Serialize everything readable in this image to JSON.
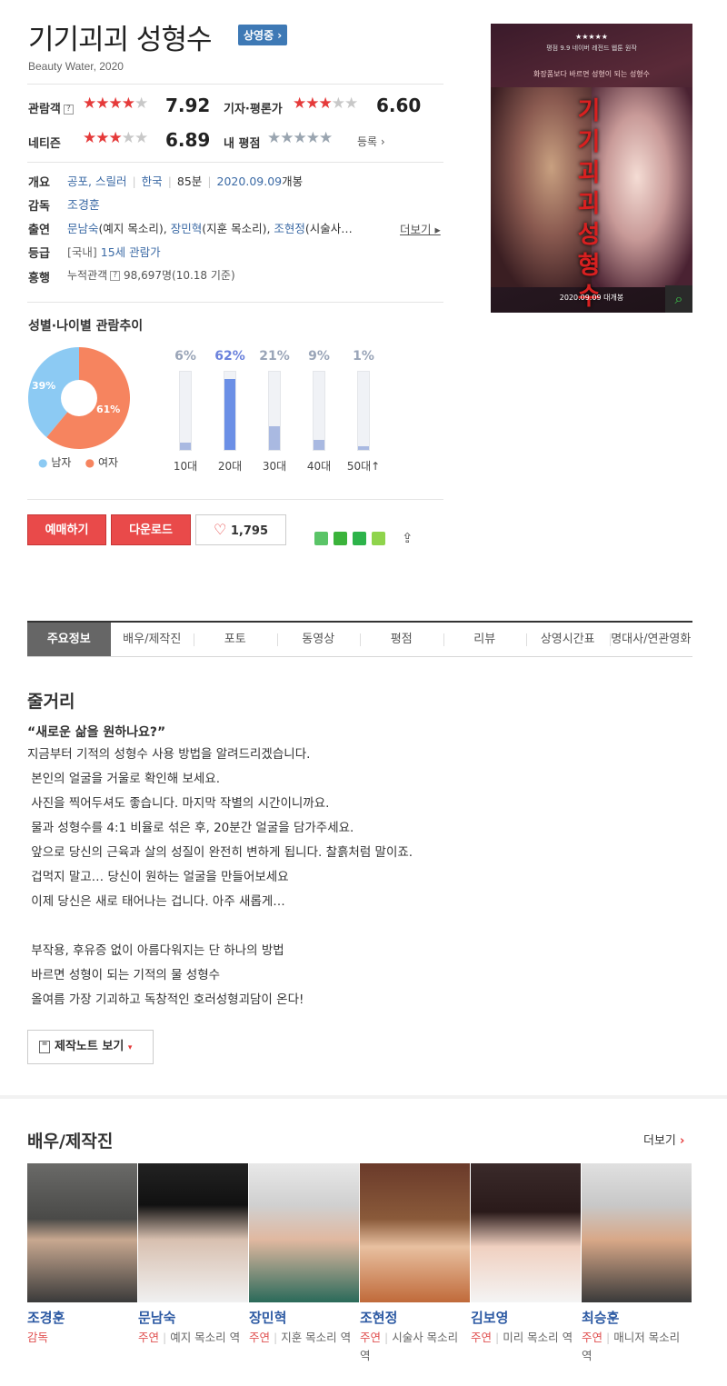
{
  "movie": {
    "title": "기기괴괴 성형수",
    "status_badge": "상영중",
    "subtitle": "Beauty Water, 2020"
  },
  "ratings": {
    "audience": {
      "label": "관람객",
      "score": "7.92",
      "stars": 4
    },
    "critics": {
      "label": "기자·평론가",
      "score": "6.60",
      "stars": 3.5
    },
    "netizen": {
      "label": "네티즌",
      "score": "6.89",
      "stars": 3.5
    },
    "my": {
      "label": "내 평점",
      "action": "등록"
    }
  },
  "info": {
    "overview_label": "개요",
    "genres": "공포, 스릴러",
    "country": "한국",
    "runtime": "85분",
    "release_date": "2020.09.09",
    "release_suffix": "개봉",
    "director_label": "감독",
    "director": "조경훈",
    "cast_label": "출연",
    "cast": [
      {
        "name": "문남숙",
        "role": "(예지 목소리), "
      },
      {
        "name": "장민혁",
        "role": "(지훈 목소리), "
      },
      {
        "name": "조현정",
        "role": "(시술사…"
      }
    ],
    "more_label": "더보기",
    "grade_label": "등급",
    "grade_prefix": "[국내]",
    "grade": "15세 관람가",
    "boxoffice_label": "흥행",
    "boxoffice_prefix": "누적관객",
    "boxoffice_value": "98,697명(10.18 기준)"
  },
  "demographics": {
    "title": "성별·나이별 관람추이",
    "gender": {
      "male_pct": "39%",
      "female_pct": "61%",
      "male_label": "남자",
      "female_label": "여자",
      "male_color": "#8ccaf3",
      "female_color": "#f6845f",
      "male_value": 39,
      "female_value": 61
    },
    "ages": [
      {
        "label": "10대",
        "pct": "6%",
        "value": 6
      },
      {
        "label": "20대",
        "pct": "62%",
        "value": 62,
        "highlight": true
      },
      {
        "label": "30대",
        "pct": "21%",
        "value": 21
      },
      {
        "label": "40대",
        "pct": "9%",
        "value": 9
      },
      {
        "label": "50대↑",
        "pct": "1%",
        "value": 1
      }
    ]
  },
  "actions": {
    "reserve": "예매하기",
    "download": "다운로드",
    "likes": "1,795"
  },
  "tabs": [
    "주요정보",
    "배우/제작진",
    "포토",
    "동영상",
    "평점",
    "리뷰",
    "상영시간표",
    "명대사/연관영화"
  ],
  "plot": {
    "title": "줄거리",
    "headline": "“새로운 삶을 원하나요?”",
    "lines": [
      "지금부터 기적의 성형수 사용 방법을 알려드리겠습니다.",
      " 본인의 얼굴을 거울로 확인해 보세요.",
      " 사진을 찍어두셔도 좋습니다. 마지막 작별의 시간이니까요.",
      " 물과 성형수를 4:1 비율로 섞은 후, 20분간 얼굴을 담가주세요.",
      " 앞으로 당신의 근육과 살의 성질이 완전히 변하게 됩니다. 찰흙처럼 말이죠.",
      " 겁먹지 말고… 당신이 원하는 얼굴을 만들어보세요",
      " 이제 당신은 새로 태어나는 겁니다. 아주 새롭게…",
      "",
      " 부작용, 후유증 없이 아름다워지는 단 하나의 방법",
      " 바르면 성형이 되는 기적의 물 성형수",
      " 올여름 가장 기괴하고 독창적인 호러성형괴담이 온다!"
    ],
    "note_button": "제작노트 보기"
  },
  "people": {
    "title": "배우/제작진",
    "more": "더보기",
    "list": [
      {
        "name": "조경훈",
        "type": "감독",
        "role": ""
      },
      {
        "name": "문남숙",
        "type": "주연",
        "role": "예지 목소리 역"
      },
      {
        "name": "장민혁",
        "type": "주연",
        "role": "지훈 목소리 역"
      },
      {
        "name": "조현정",
        "type": "주연",
        "role": "시술사 목소리 역"
      },
      {
        "name": "김보영",
        "type": "주연",
        "role": "미리 목소리 역"
      },
      {
        "name": "최승훈",
        "type": "주연",
        "role": "매니저 목소리 역"
      }
    ]
  },
  "poster": {
    "tagline": "평점 9.9 네이버 레전드 웹툰 원작",
    "copy": "화장품보다 바르면 성형이 되는 성형수",
    "title": "기기괴괴 성형수",
    "date": "2020.09.09 대개봉"
  }
}
